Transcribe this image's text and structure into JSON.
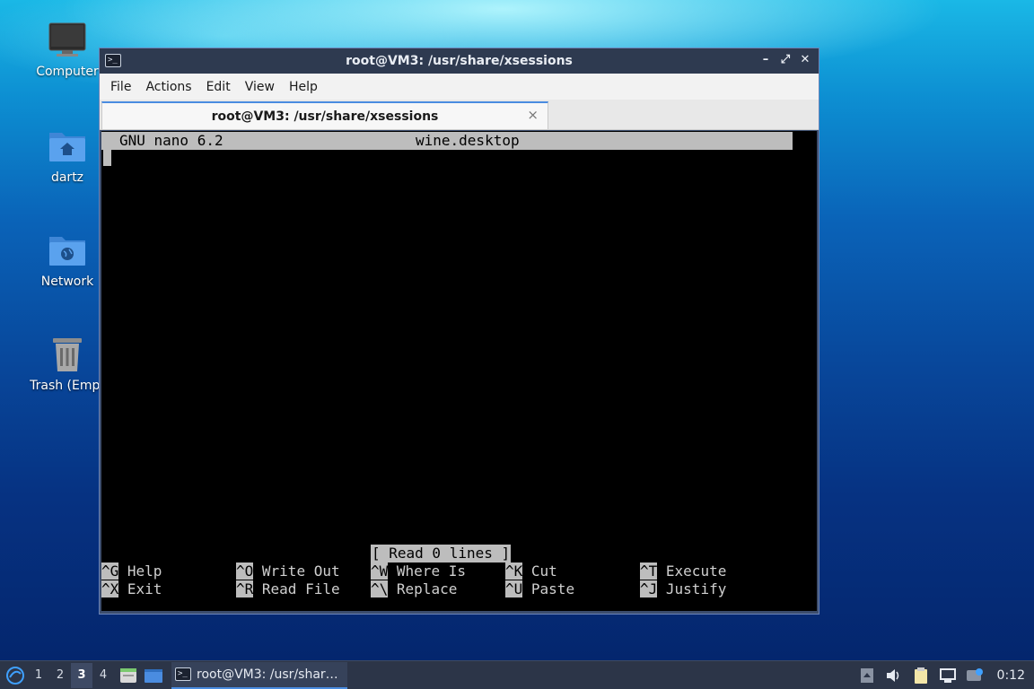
{
  "desktop": {
    "icons": [
      {
        "label": "Computer",
        "icon": "monitor-icon"
      },
      {
        "label": "dartz",
        "icon": "home-folder-icon"
      },
      {
        "label": "Network",
        "icon": "network-folder-icon"
      },
      {
        "label": "Trash (Empt",
        "icon": "trash-icon"
      }
    ]
  },
  "window": {
    "title": "root@VM3: /usr/share/xsessions",
    "controls": [
      "–",
      "⤢",
      "✕"
    ],
    "menu": [
      "File",
      "Actions",
      "Edit",
      "View",
      "Help"
    ],
    "tab": {
      "title": "root@VM3: /usr/share/xsessions",
      "close": "×"
    }
  },
  "nano": {
    "version": "GNU nano 6.2",
    "filename": "wine.desktop",
    "status": "[ Read 0 lines ]",
    "shortcuts": [
      {
        "key": "^G",
        "action": "Help"
      },
      {
        "key": "^O",
        "action": "Write Out"
      },
      {
        "key": "^W",
        "action": "Where Is"
      },
      {
        "key": "^K",
        "action": "Cut"
      },
      {
        "key": "^T",
        "action": "Execute"
      },
      {
        "key": "^X",
        "action": "Exit"
      },
      {
        "key": "^R",
        "action": "Read File"
      },
      {
        "key": "^\\",
        "action": "Replace"
      },
      {
        "key": "^U",
        "action": "Paste"
      },
      {
        "key": "^J",
        "action": "Justify"
      }
    ]
  },
  "taskbar": {
    "workspaces": [
      "1",
      "2",
      "3",
      "4"
    ],
    "active_workspace": "3",
    "task_label": "root@VM3: /usr/shar…",
    "clock": "0:12",
    "colors": {
      "accent": "#4a8ce0",
      "panel": "#2c3548"
    }
  }
}
